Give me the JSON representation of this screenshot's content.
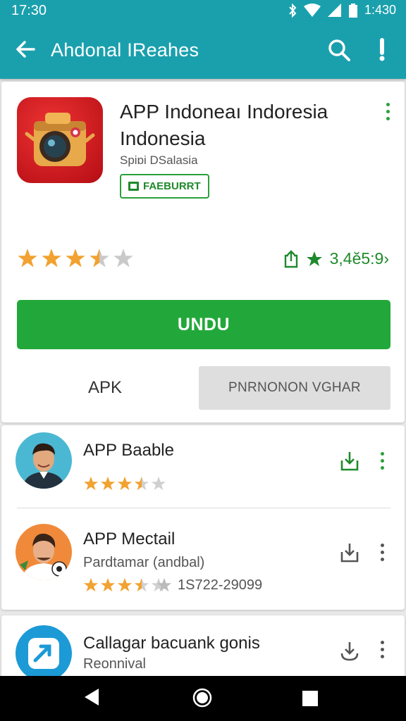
{
  "status_bar": {
    "time": "17:30",
    "clock_right": "1:430",
    "icons": [
      "bluetooth-icon",
      "wifi-icon",
      "signal-icon",
      "battery-icon"
    ]
  },
  "toolbar": {
    "title": "Ahdonal IReahes",
    "back_icon": "back-arrow-icon",
    "search_icon": "search-icon",
    "alert_icon": "alert-icon"
  },
  "app": {
    "title": "APP Indoneaı Indoresia Indonesia",
    "developer": "Spiɒi DSalasia",
    "badge": "FAEBURRT",
    "rating_stars": 3.5,
    "rating_count": "3,4ĕ5:9›",
    "install_label": "UNDU",
    "apk_label": "APK",
    "secondary_label": "PNRNONON VGHAR"
  },
  "list": [
    {
      "name": "APP Baable",
      "rating_stars": 3.5,
      "action": "download-icon"
    },
    {
      "name": "APP Mectail",
      "subtitle": "Pardtamar (andbal)",
      "rating_stars": 3.5,
      "extra": "1S722-29099",
      "action": "download-icon"
    }
  ],
  "bottom_item": {
    "name": "Callagar bacuank gonis",
    "subtitle": "Reonnival",
    "action": "download-icon"
  },
  "colors": {
    "accent": "#1aa0ad",
    "install": "#22a83a",
    "star": "#f2a230",
    "green_text": "#1f8a2c"
  }
}
